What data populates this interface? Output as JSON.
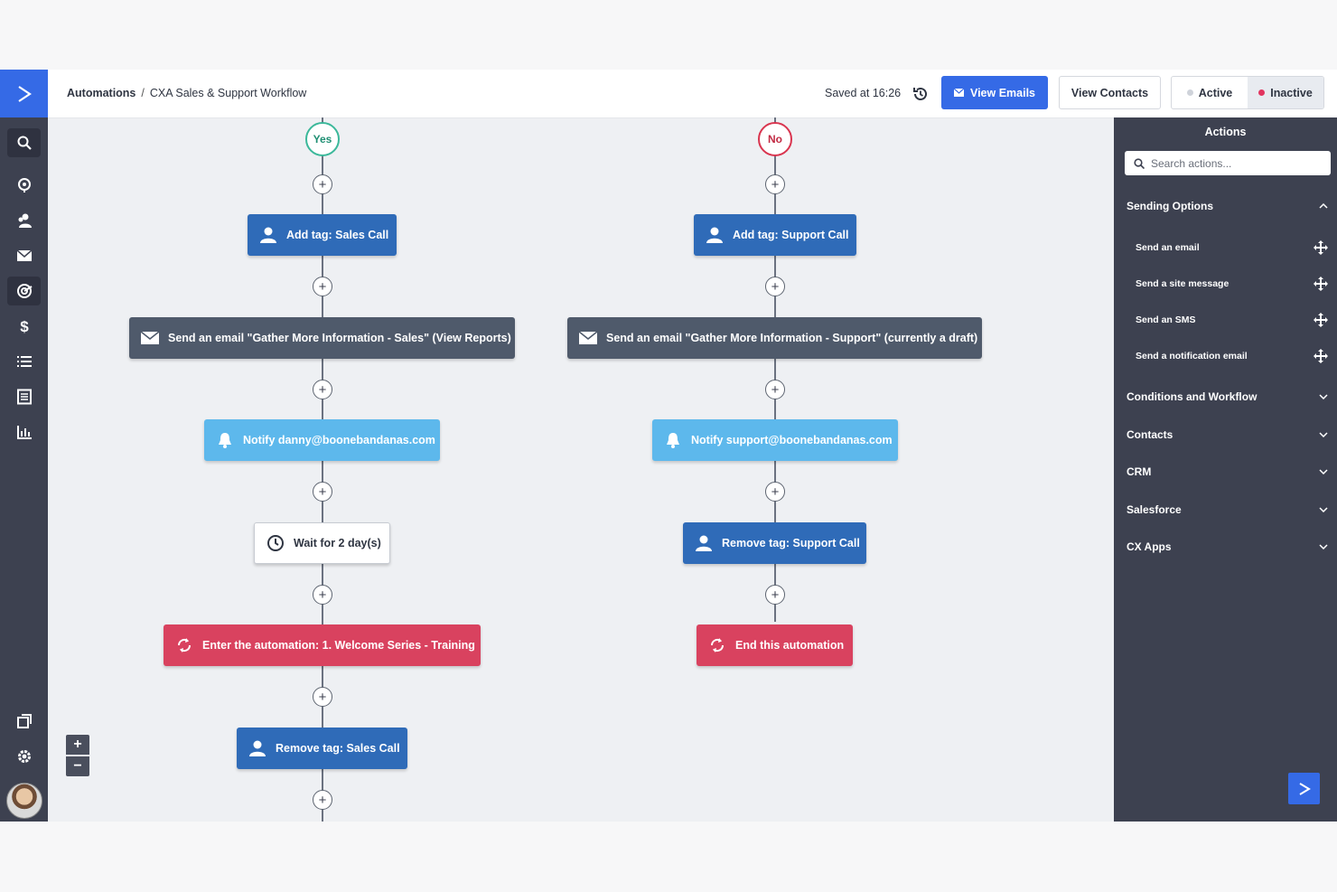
{
  "breadcrumb": {
    "root": "Automations",
    "separator": "/",
    "current": "CXA Sales & Support Workflow"
  },
  "header": {
    "saved_text": "Saved at 16:26",
    "view_emails_label": "View Emails",
    "view_contacts_label": "View Contacts",
    "status": {
      "active_label": "Active",
      "inactive_label": "Inactive",
      "selected": "Inactive"
    }
  },
  "colors": {
    "brand": "#356ae6",
    "tag_action": "#2f6bb8",
    "email_action": "#4f5a6b",
    "notify_action": "#5db8ec",
    "flow_action": "#d9425f",
    "yes": "#3bb89a",
    "no": "#d9354f"
  },
  "leftnav": {
    "icons": [
      "search-icon",
      "pin-icon",
      "contacts-icon",
      "email-icon",
      "automations-icon",
      "dollar-icon",
      "list-icon",
      "forms-icon",
      "reports-icon",
      "pages-icon",
      "settings-icon"
    ],
    "active": "automations-icon"
  },
  "workflow": {
    "yes_branch": {
      "label": "Yes",
      "steps": [
        {
          "type": "tag",
          "icon": "user-icon",
          "label": "Add tag: Sales Call"
        },
        {
          "type": "email",
          "icon": "envelope-icon",
          "label": "Send an email \"Gather More Information - Sales\" (View Reports)"
        },
        {
          "type": "notify",
          "icon": "bell-icon",
          "label": "Notify danny@boonebandanas.com"
        },
        {
          "type": "wait",
          "icon": "clock-icon",
          "label": "Wait for 2 day(s)"
        },
        {
          "type": "flow",
          "icon": "refresh-icon",
          "label": "Enter the automation: 1. Welcome Series - Training"
        },
        {
          "type": "tag",
          "icon": "user-icon",
          "label": "Remove tag: Sales Call"
        }
      ]
    },
    "no_branch": {
      "label": "No",
      "steps": [
        {
          "type": "tag",
          "icon": "user-icon",
          "label": "Add tag: Support Call"
        },
        {
          "type": "email",
          "icon": "envelope-icon",
          "label": "Send an email \"Gather More Information - Support\" (currently a draft)"
        },
        {
          "type": "notify",
          "icon": "bell-icon",
          "label": "Notify support@boonebandanas.com"
        },
        {
          "type": "tag",
          "icon": "user-icon",
          "label": "Remove tag: Support Call"
        },
        {
          "type": "flow",
          "icon": "refresh-icon",
          "label": "End this automation"
        }
      ]
    }
  },
  "zoom": {
    "in_label": "+",
    "out_label": "−"
  },
  "actions_panel": {
    "title": "Actions",
    "search_placeholder": "Search actions...",
    "sections": [
      {
        "label": "Sending Options",
        "expanded": true,
        "items": [
          "Send an email",
          "Send a site message",
          "Send an SMS",
          "Send a notification email"
        ]
      },
      {
        "label": "Conditions and Workflow",
        "expanded": false
      },
      {
        "label": "Contacts",
        "expanded": false
      },
      {
        "label": "CRM",
        "expanded": false
      },
      {
        "label": "Salesforce",
        "expanded": false
      },
      {
        "label": "CX Apps",
        "expanded": false
      }
    ]
  }
}
